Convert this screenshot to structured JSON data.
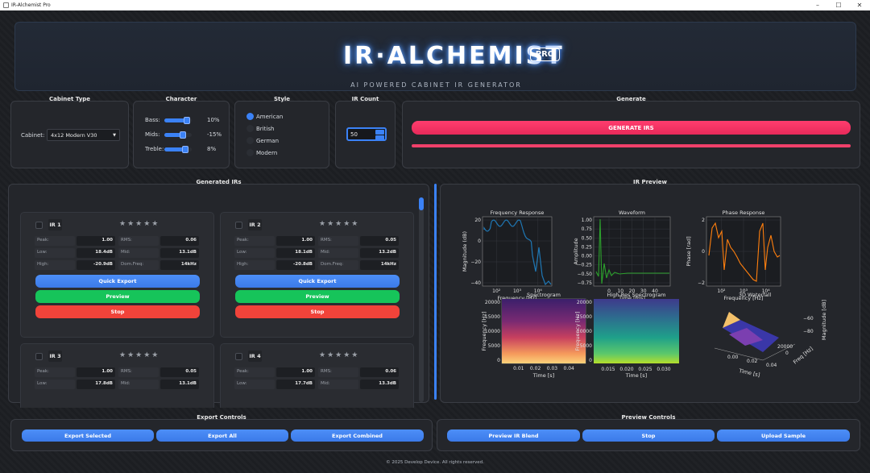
{
  "window": {
    "title": "IR-Alchemist Pro",
    "controls": [
      "–",
      "☐",
      "✕"
    ]
  },
  "header": {
    "title": "IR·ALCHEMIST",
    "badge": "PRO",
    "subtitle": "AI POWERED CABINET IR GENERATOR"
  },
  "cabinet": {
    "title": "Cabinet Type",
    "label": "Cabinet:",
    "value": "4x12 Modern V30"
  },
  "character": {
    "title": "Character",
    "items": [
      {
        "label": "Bass:",
        "value": "10%",
        "level": 0.55
      },
      {
        "label": "Mids:",
        "value": "-15%",
        "level": 0.42
      },
      {
        "label": "Treble:",
        "value": "8%",
        "level": 0.54
      }
    ]
  },
  "style": {
    "title": "Style",
    "options": [
      "American",
      "British",
      "German",
      "Modern"
    ],
    "selected": "American"
  },
  "ircount": {
    "title": "IR Count",
    "value": "50"
  },
  "generate": {
    "title": "Generate",
    "button": "GENERATE IRS",
    "progress": 1.0
  },
  "generated": {
    "title": "Generated IRs",
    "cards": [
      {
        "name": "IR 1",
        "stars": "★★★★★",
        "peak": "1.00",
        "rms": "0.06",
        "low": "18.4dB",
        "mid": "13.1dB",
        "high": "-20.9dB",
        "domfreq": "14kHz"
      },
      {
        "name": "IR 2",
        "stars": "★★★★★",
        "peak": "1.00",
        "rms": "0.05",
        "low": "18.1dB",
        "mid": "13.2dB",
        "high": "-20.8dB",
        "domfreq": "14kHz"
      },
      {
        "name": "IR 3",
        "stars": "★★★★★",
        "peak": "1.00",
        "rms": "0.05",
        "low": "17.8dB",
        "mid": "13.1dB"
      },
      {
        "name": "IR 4",
        "stars": "★★★★★",
        "peak": "1.00",
        "rms": "0.06",
        "low": "17.7dB",
        "mid": "13.3dB"
      }
    ],
    "labels": {
      "peak": "Peak:",
      "rms": "RMS:",
      "low": "Low:",
      "mid": "Mid:",
      "high": "High:",
      "domfreq": "Dom.Freq:"
    },
    "buttons": {
      "quick_export": "Quick Export",
      "preview": "Preview",
      "stop": "Stop"
    }
  },
  "preview": {
    "title": "IR Preview",
    "plots": {
      "freq": {
        "title": "Frequency Response",
        "xlabel": "Frequency [Hz]",
        "ylabel": "Magnitude (dB)",
        "yticks": [
          "20",
          "0",
          "−20",
          "−40"
        ],
        "xticks": [
          "10²",
          "10³",
          "10⁴"
        ]
      },
      "wave": {
        "title": "Waveform",
        "xlabel": "Time [ms]",
        "ylabel": "Amplitude",
        "yticks": [
          "1.00",
          "0.75",
          "0.50",
          "0.25",
          "0.00",
          "−0.25",
          "−0.50",
          "−0.75"
        ],
        "xticks": [
          "0",
          "10",
          "20",
          "30",
          "40"
        ]
      },
      "phase": {
        "title": "Phase Response",
        "xlabel": "Frequency [Hz]",
        "ylabel": "Phase [rad]",
        "yticks": [
          "2",
          "0",
          "−2"
        ],
        "xticks": [
          "10²",
          "10³",
          "10⁴"
        ]
      },
      "spec": {
        "title": "Spectrogram",
        "xlabel": "Time [s]",
        "ylabel": "Frequency [Hz]",
        "yticks": [
          "20000",
          "15000",
          "10000",
          "5000",
          "0"
        ],
        "xticks": [
          "0.01",
          "0.02",
          "0.03",
          "0.04"
        ]
      },
      "hires": {
        "title": "High-Res Spectrogram",
        "xlabel": "Time [s]",
        "ylabel": "Frequency [Hz]",
        "yticks": [
          "20000",
          "15000",
          "10000",
          "5000",
          "0"
        ],
        "xticks": [
          "0.015",
          "0.020",
          "0.025",
          "0.030"
        ]
      },
      "surface": {
        "title": "3D Waterfall",
        "xlabel": "Time [s]",
        "ylabel": "Freq [Hz]",
        "zlabel": "Magnitude [dB]",
        "xticks": [
          "0.00",
          "0.02",
          "0.04"
        ],
        "yticks": [
          "20000",
          "0"
        ],
        "zticks": [
          "−60",
          "−80"
        ]
      }
    }
  },
  "export": {
    "title": "Export Controls",
    "buttons": [
      "Export Selected",
      "Export All",
      "Export Combined"
    ]
  },
  "preview_controls": {
    "title": "Preview Controls",
    "buttons": [
      "Preview IR Blend",
      "Stop",
      "Upload Sample"
    ]
  },
  "footer": "© 2025 Develop Device. All rights reserved.",
  "colors": {
    "accent": "#3b82f6",
    "generate": "#f0406a",
    "green": "#16c45a",
    "red": "#f1433a",
    "freq_line": "#1f77b4",
    "wave_line": "#2ca02c",
    "phase_line": "#ff7f0e"
  }
}
